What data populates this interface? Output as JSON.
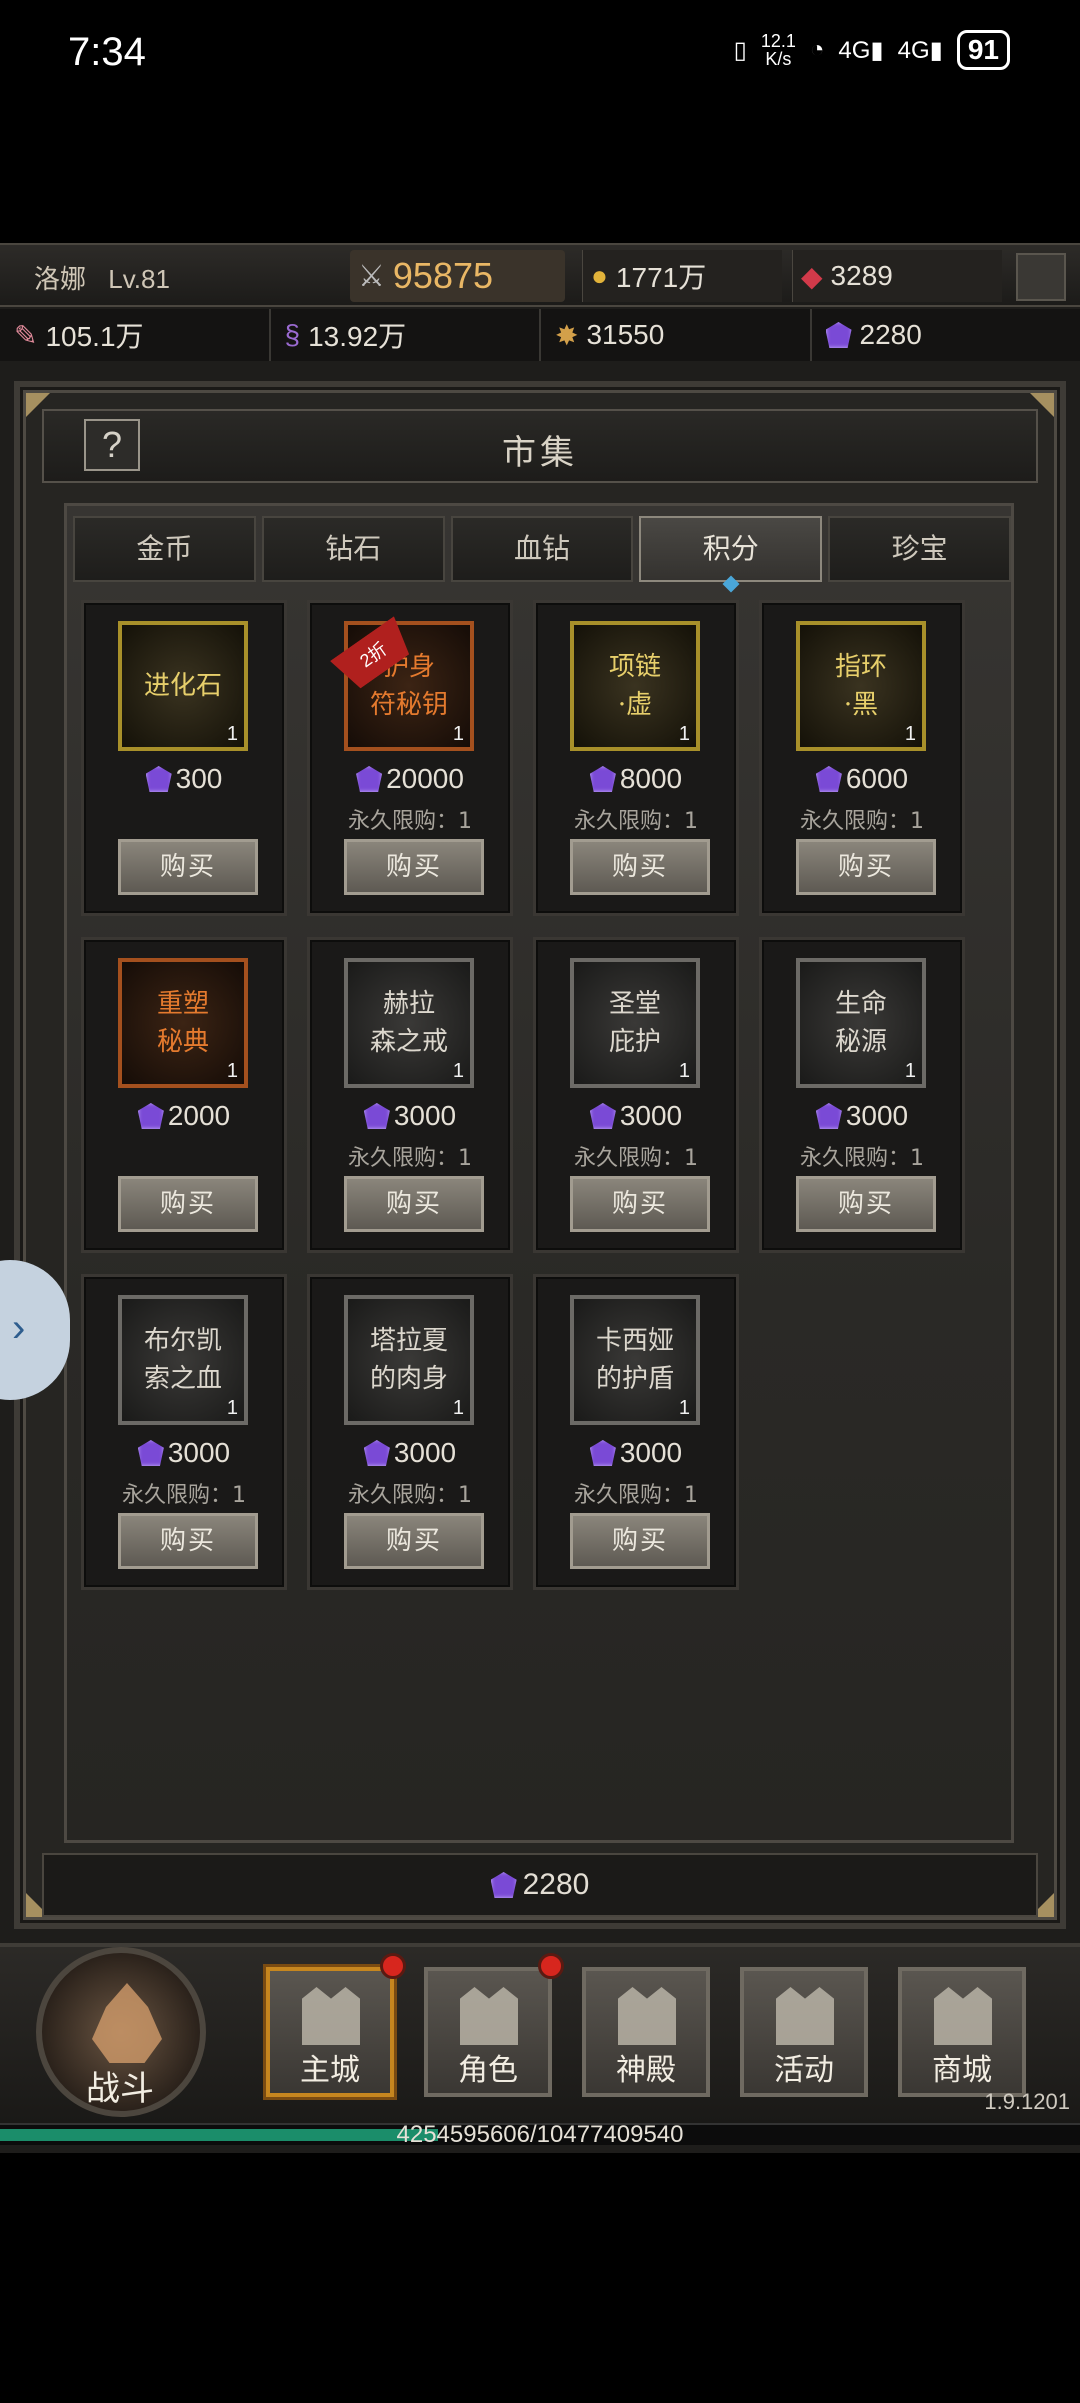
{
  "status_bar": {
    "time": "7:34",
    "speed": "12.1\nK/s",
    "battery": "91"
  },
  "player": {
    "name": "洛娜",
    "level": "Lv.81",
    "power": "95875",
    "gold": "1771万",
    "diamonds": "3289"
  },
  "resources": [
    {
      "icon": "scroll-icon",
      "value": "105.1万"
    },
    {
      "icon": "rune-icon",
      "value": "13.92万"
    },
    {
      "icon": "emblem-icon",
      "value": "31550"
    },
    {
      "icon": "purple-gem-icon",
      "value": "2280"
    }
  ],
  "market": {
    "title": "市集",
    "help": "?",
    "tabs": [
      "金币",
      "钻石",
      "血钻",
      "积分",
      "珍宝"
    ],
    "active_tab": "积分",
    "buy_label": "购买",
    "items": [
      {
        "name": "进化石",
        "qty": "1",
        "price": "300",
        "limit": "",
        "frame": "gold"
      },
      {
        "name": "护身\n符秘钥",
        "qty": "1",
        "price": "20000",
        "limit": "永久限购：1",
        "frame": "orange",
        "badge": "2折"
      },
      {
        "name": "项链\n·虚",
        "qty": "1",
        "price": "8000",
        "limit": "永久限购：1",
        "frame": "gold"
      },
      {
        "name": "指环\n·黑",
        "qty": "1",
        "price": "6000",
        "limit": "永久限购：1",
        "frame": "gold"
      },
      {
        "name": "重塑\n秘典",
        "qty": "1",
        "price": "2000",
        "limit": "",
        "frame": "orange"
      },
      {
        "name": "赫拉\n森之戒",
        "qty": "1",
        "price": "3000",
        "limit": "永久限购：1",
        "frame": "grey"
      },
      {
        "name": "圣堂\n庇护",
        "qty": "1",
        "price": "3000",
        "limit": "永久限购：1",
        "frame": "grey"
      },
      {
        "name": "生命\n秘源",
        "qty": "1",
        "price": "3000",
        "limit": "永久限购：1",
        "frame": "grey"
      },
      {
        "name": "布尔凯\n索之血",
        "qty": "1",
        "price": "3000",
        "limit": "永久限购：1",
        "frame": "grey"
      },
      {
        "name": "塔拉夏\n的肉身",
        "qty": "1",
        "price": "3000",
        "limit": "永久限购：1",
        "frame": "grey"
      },
      {
        "name": "卡西娅\n的护盾",
        "qty": "1",
        "price": "3000",
        "limit": "永久限购：1",
        "frame": "grey"
      }
    ],
    "balance": "2280"
  },
  "nav": {
    "battle": "战斗",
    "buttons": [
      {
        "label": "主城",
        "icon": "castle-icon",
        "active": true,
        "badge": true
      },
      {
        "label": "角色",
        "icon": "helmet-icon",
        "active": false,
        "badge": true
      },
      {
        "label": "神殿",
        "icon": "temple-icon",
        "active": false,
        "badge": false
      },
      {
        "label": "活动",
        "icon": "banner-icon",
        "active": false,
        "badge": false
      },
      {
        "label": "商城",
        "icon": "diamond-icon",
        "active": false,
        "badge": false
      }
    ],
    "version": "1.9.1201"
  },
  "experience": {
    "text": "4254595606/10477409540",
    "progress": 0.406
  }
}
